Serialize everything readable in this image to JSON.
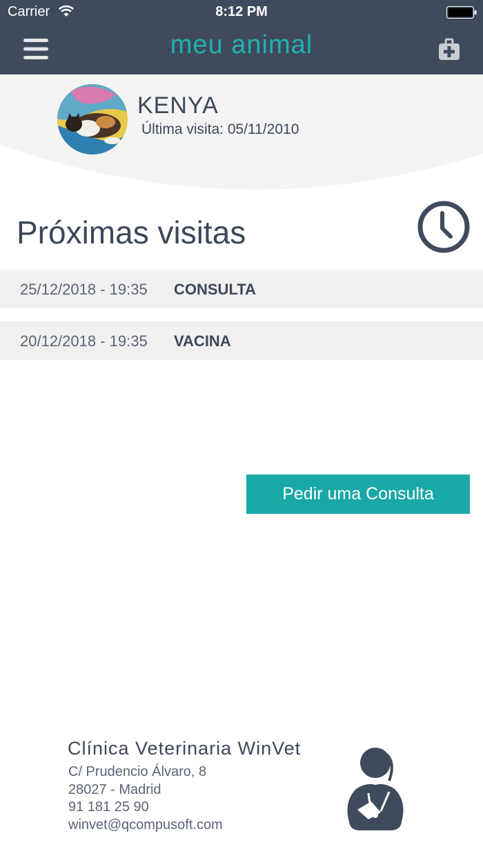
{
  "status_bar": {
    "carrier": "Carrier",
    "time": "8:12 PM",
    "icons": [
      "wifi-icon",
      "battery-icon"
    ]
  },
  "header": {
    "title": "meu animal",
    "left_icon": "menu-icon",
    "right_icon": "first-aid-kit-icon",
    "background_color": "#3f4a5c",
    "title_color": "#1fb2b0"
  },
  "pet": {
    "name": "KENYA",
    "last_visit": "Última visita: 05/11/2010",
    "avatar": "pet-avatar"
  },
  "upcoming": {
    "title": "Próximas visitas",
    "icon": "clock-icon",
    "visits": [
      {
        "date": "25/12/2018 - 19:35",
        "type": "CONSULTA"
      },
      {
        "date": "20/12/2018 - 19:35",
        "type": "VACINA"
      }
    ]
  },
  "actions": {
    "request_appointment": "Pedir uma Consulta",
    "accent_color": "#1aa8a6"
  },
  "clinic": {
    "name": "Clínica Veterinaria WinVet",
    "address": "C/ Prudencio Álvaro, 8",
    "city": "28027 - Madrid",
    "phone": "91 181 25 90",
    "email": "winvet@qcompusoft.com",
    "icon": "veterinarian-icon"
  }
}
